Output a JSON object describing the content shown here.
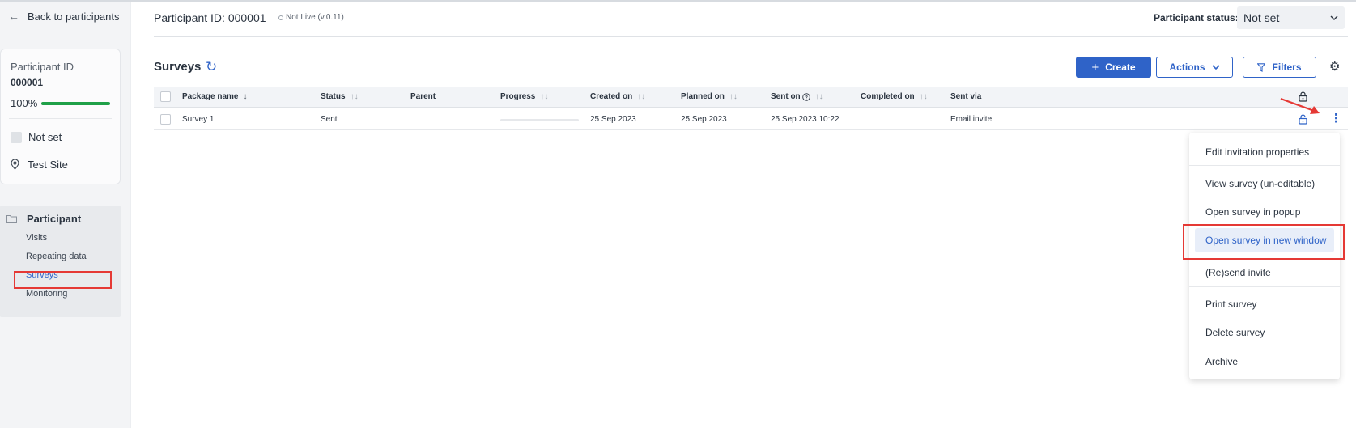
{
  "sidebar": {
    "back_label": "Back to participants",
    "participant_id_label": "Participant ID",
    "participant_id": "000001",
    "progress_pct": "100%",
    "progress_value": 1.0,
    "status": "Not set",
    "site": "Test Site",
    "nav_heading": "Participant",
    "nav_items": [
      "Visits",
      "Repeating data",
      "Surveys",
      "Monitoring"
    ],
    "active_item": "Surveys"
  },
  "header": {
    "title": "Participant ID: 000001",
    "live_status": "Not Live (v.0.11)",
    "participant_status_label": "Participant status:",
    "participant_status_value": "Not set"
  },
  "surveys": {
    "title": "Surveys",
    "create_label": "Create",
    "actions_label": "Actions",
    "filters_label": "Filters",
    "columns": [
      "Package name",
      "Status",
      "Parent",
      "Progress",
      "Created on",
      "Planned on",
      "Sent on",
      "Completed on",
      "Sent via"
    ],
    "rows": [
      {
        "package_name": "Survey 1",
        "status": "Sent",
        "parent": "",
        "progress": 0,
        "created_on": "25 Sep 2023",
        "planned_on": "25 Sep 2023",
        "sent_on": "25 Sep 2023 10:22",
        "completed_on": "",
        "sent_via": "Email invite"
      }
    ]
  },
  "context_menu": {
    "items": [
      "Edit invitation properties",
      "View survey (un-editable)",
      "Open survey in popup",
      "Open survey in new window",
      "(Re)send invite",
      "Print survey",
      "Delete survey",
      "Archive"
    ],
    "highlighted_item": "Open survey in new window"
  },
  "colors": {
    "accent": "#2f63c8",
    "highlight_annotation": "#e53935",
    "progress_green": "#1fa048"
  }
}
